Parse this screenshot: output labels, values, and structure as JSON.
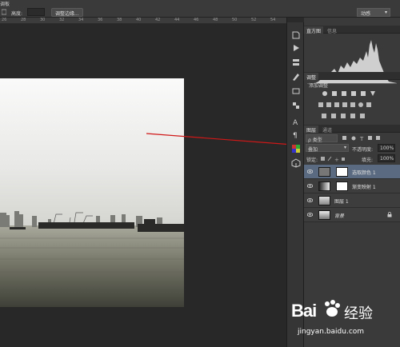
{
  "optbar": {
    "corner_text": "调板",
    "height_label": "高度:",
    "refine_edge_button": "调整边缘...",
    "workspace_dropdown": "动感"
  },
  "ruler": {
    "ticks": [
      "26",
      "28",
      "30",
      "32",
      "34",
      "36",
      "38",
      "40",
      "42",
      "44",
      "46",
      "48",
      "50",
      "52",
      "54"
    ]
  },
  "histogram_panel": {
    "tabs": [
      "直方图",
      "信息"
    ]
  },
  "adjustments_panel": {
    "tabs": [
      "调整"
    ],
    "title": "添加调整"
  },
  "layers_panel": {
    "tabs": [
      "图层",
      "通道"
    ],
    "filter_label": "ρ 类型",
    "blend_mode": "叠加",
    "opacity_label": "不透明度:",
    "opacity_value": "100%",
    "lock_label": "锁定:",
    "fill_label": "填充:",
    "fill_value": "100%",
    "layers": [
      {
        "name": "选取颜色 1",
        "selected": true
      },
      {
        "name": "渐变映射 1",
        "selected": false
      },
      {
        "name": "图层 1",
        "selected": false
      },
      {
        "name": "背景",
        "selected": false
      }
    ]
  },
  "watermark": {
    "brand": "Bai",
    "brand2": "经验",
    "url": "jingyan.baidu.com"
  },
  "colors": {
    "annotation_arrow": "#d01818",
    "selected_layer": "#5a6a80",
    "panel_bg": "#3a3a3a"
  }
}
